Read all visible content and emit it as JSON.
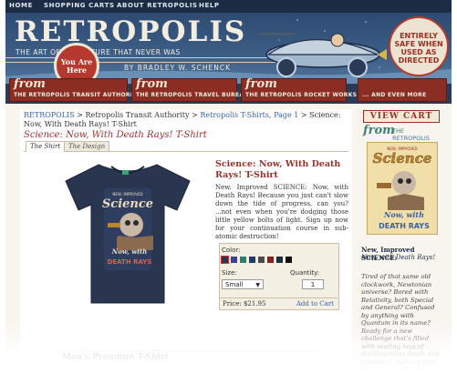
{
  "nav": [
    "HOME",
    "SHOPPING CARTS",
    "ABOUT RETROPOLIS",
    "HELP"
  ],
  "banner": {
    "logo": "RETROPOLIS",
    "tagline": "THE ART OF THE FUTURE THAT NEVER WAS",
    "byline": "BY BRADLEY W. SCHENCK",
    "you_are_here": "You Are Here",
    "seal": "ENTIRELY SAFE WHEN USED AS DIRECTED"
  },
  "sections": [
    {
      "from": "from",
      "name": "THE RETROPOLIS TRANSIT AUTHORITY"
    },
    {
      "from": "from",
      "name": "THE RETROPOLIS TRAVEL BUREAU"
    },
    {
      "from": "from",
      "name": "THE RETROPOLIS ROCKET WORKS"
    },
    {
      "from": "",
      "name": "... AND EVEN MORE"
    }
  ],
  "breadcrumb": {
    "home": "RETROPOLIS",
    "sep": " > ",
    "section": "Retropolis Transit Authority",
    "category": "Retropolis T-Shirts, Page 1",
    "current": "Science: Now, With Death Rays! T-Shirt"
  },
  "page_title": "Science: Now, With Death Rays! T-Shirt",
  "tabs": [
    "The Shirt",
    "The Design"
  ],
  "product": {
    "title": "Science: Now, With Death Rays! T-Shirt",
    "description": "New, Improved SCIENCE: Now, with Death Rays! Because you just can't slow down the tide of progress, can you? ...not even when you're dodging those little yellow bolts of light. Sign up now for your continuation course in sub-atomic destruction!",
    "shirt_art": {
      "top": "NEW, IMPROVED",
      "main": "Science",
      "sub": "Now, with",
      "rays": "DEATH RAYS"
    }
  },
  "order": {
    "color_label": "Color:",
    "swatches": [
      "#2a3550",
      "#3a3f9a",
      "#2b7f6e",
      "#1f3d6b",
      "#4a4a4a",
      "#8b1f1f",
      "#1d2b45",
      "#111111"
    ],
    "size_label": "Size:",
    "size_value": "Small",
    "qty_label": "Quantity:",
    "qty_value": "1",
    "price": "Price: $21.95",
    "add_to_cart": "Add to Cart"
  },
  "mens_title": "Men's Premium T-Shirt",
  "sidebar": {
    "view_cart": "VIEW CART",
    "from": "from",
    "authority": "THE RETROPOLIS TRANSIT AUTHORITY",
    "poster": {
      "top": "NEW, IMPROVED",
      "main": "Science",
      "sub": "Now, with",
      "rays": "DEATH RAYS"
    },
    "title": "New, Improved SCIENCE:",
    "subtitle": "Now, with Death Rays!",
    "body": "Tired of that same old clockwork, Newtonian universe? Bored with Relativity, both Special and General? Confused by anything with Quantum in its name? Ready for a new challenge that's filled with searing rays of disintegrating death and mayhem? Then try New, Improved SCIENCE!"
  }
}
